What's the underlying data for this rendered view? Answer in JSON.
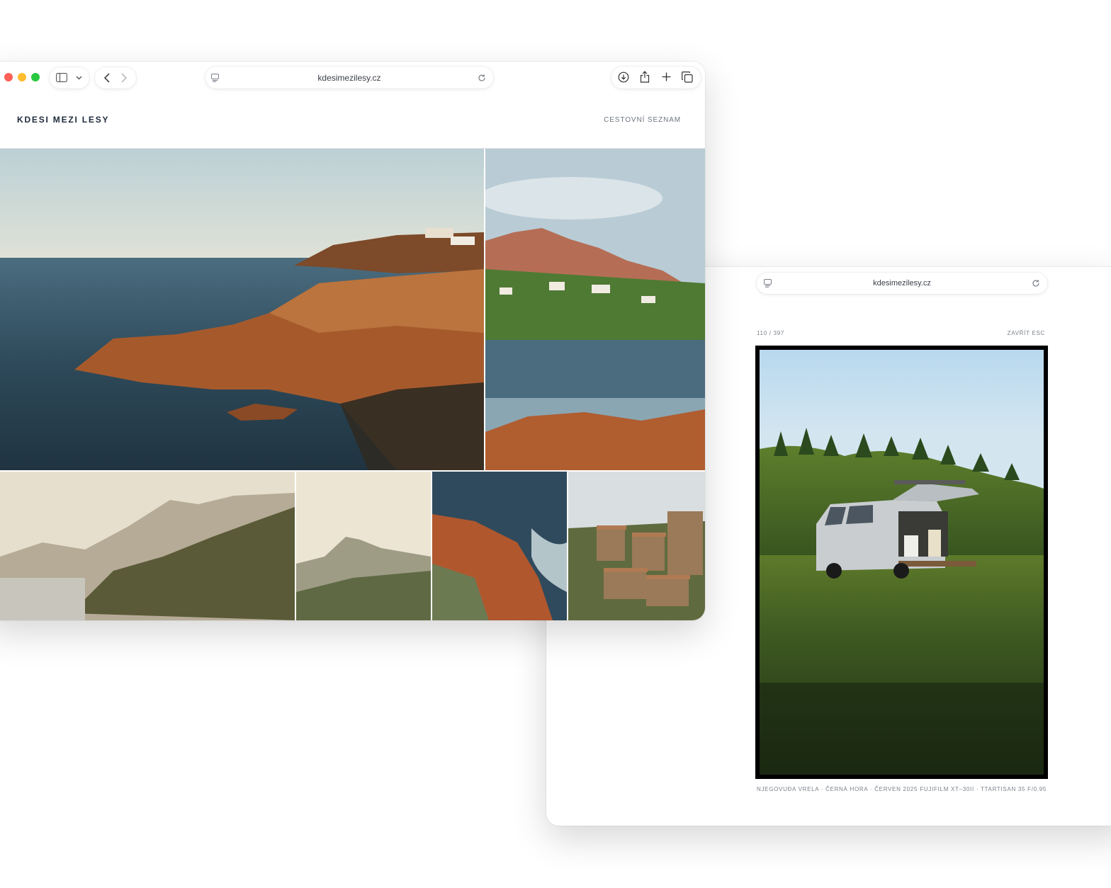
{
  "front_window": {
    "address": "kdesimezilesy.cz",
    "site": {
      "brand": "KDESI MEZI LESY",
      "nav_link": "CESTOVNÍ SEZNAM"
    },
    "toolbar_icons": [
      "sidebar-icon",
      "chevron-down-icon",
      "back-arrow-icon",
      "forward-arrow-icon",
      "reader-icon",
      "reload-icon",
      "download-icon",
      "share-icon",
      "new-tab-icon",
      "tabs-overview-icon"
    ],
    "traffic_lights": {
      "close": "#fe5f57",
      "minimize": "#febc2e",
      "zoom": "#28c840"
    },
    "gallery": [
      {
        "subject": "rocky red coast and sea at sunset"
      },
      {
        "subject": "red mountain above coastal village"
      },
      {
        "subject": "hazy coastal hills"
      },
      {
        "subject": "misty mountain silhouette"
      },
      {
        "subject": "red rocks and waves"
      },
      {
        "subject": "hillside stone village"
      }
    ]
  },
  "back_window": {
    "address": "kdesimezilesy.cz",
    "lightbox": {
      "counter": "110 / 397",
      "close_label": "ZAVŘÍT ESC",
      "caption_location": "NJEGOVUĐA VRELA · ČERNÁ HORA · ČERVEN 2025",
      "caption_camera": "FUJIFILM XT–30II · TTARTISAN 35 F/0.95",
      "photo_subject": "van with open tailgate in forest meadow"
    }
  }
}
